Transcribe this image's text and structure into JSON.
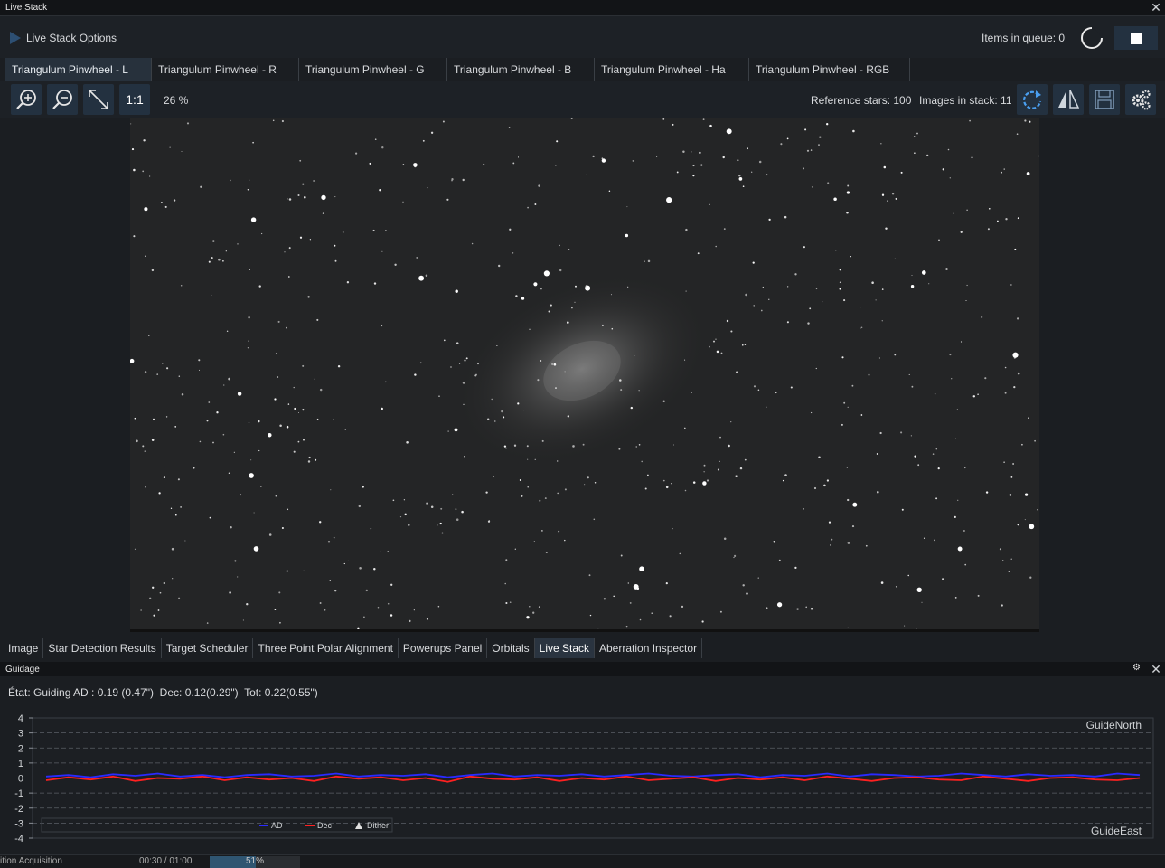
{
  "window_title": "Live Stack",
  "options": {
    "label": "Live Stack Options",
    "queue_label": "Items in queue: 0"
  },
  "tabs": [
    {
      "label": "Triangulum Pinwheel - L",
      "active": true
    },
    {
      "label": "Triangulum Pinwheel - R",
      "active": false
    },
    {
      "label": "Triangulum Pinwheel - G",
      "active": false
    },
    {
      "label": "Triangulum Pinwheel - B",
      "active": false
    },
    {
      "label": "Triangulum Pinwheel - Ha",
      "active": false
    },
    {
      "label": "Triangulum Pinwheel - RGB",
      "active": false
    }
  ],
  "toolbar": {
    "one_to_one": "1:1",
    "zoom": "26 %",
    "reference_stars": "Reference stars: 100",
    "images_in_stack": "Images in stack: 11"
  },
  "bottom_tabs": [
    {
      "label": "Image",
      "active": false
    },
    {
      "label": "Star Detection Results",
      "active": false
    },
    {
      "label": "Target Scheduler",
      "active": false
    },
    {
      "label": "Three Point Polar Alignment",
      "active": false
    },
    {
      "label": "Powerups Panel",
      "active": false
    },
    {
      "label": "Orbitals",
      "active": false
    },
    {
      "label": "Live Stack",
      "active": true
    },
    {
      "label": "Aberration Inspector",
      "active": false
    }
  ],
  "guiding": {
    "panel_title": "Guidage",
    "state": "État: Guiding AD : 0.19 (0.47\")  Dec: 0.12(0.29\")  Tot: 0.22(0.55\")",
    "label_north": "GuideNorth",
    "label_east": "GuideEast"
  },
  "chart_data": {
    "type": "line",
    "ylim": [
      -4,
      4
    ],
    "y_ticks": [
      "4",
      "3",
      "2",
      "1",
      "0",
      "-1",
      "-2",
      "-3",
      "-4"
    ],
    "legend": [
      "AD",
      "Dec",
      "Dither"
    ],
    "series": [
      {
        "name": "AD",
        "color": "#2a2aff",
        "values": [
          0.1,
          0.2,
          0.05,
          0.25,
          0.15,
          0.3,
          0.1,
          0.2,
          0.05,
          0.2,
          0.25,
          0.1,
          0.15,
          0.3,
          0.1,
          0.2,
          0.15,
          0.25,
          0.05,
          0.2,
          0.3,
          0.1,
          0.2,
          0.15,
          0.25,
          0.1,
          0.2,
          0.3,
          0.15,
          0.1,
          0.2,
          0.25,
          0.05,
          0.2,
          0.15,
          0.3,
          0.1,
          0.25,
          0.2,
          0.1,
          0.15,
          0.3,
          0.2,
          0.1,
          0.25,
          0.15,
          0.2,
          0.1,
          0.3,
          0.2
        ]
      },
      {
        "name": "Dec",
        "color": "#ff2020",
        "values": [
          -0.15,
          0.05,
          -0.1,
          0.1,
          -0.2,
          0.0,
          -0.05,
          0.1,
          -0.15,
          0.05,
          -0.1,
          0.0,
          -0.2,
          0.1,
          -0.05,
          0.05,
          -0.15,
          0.0,
          -0.25,
          0.1,
          -0.05,
          -0.1,
          0.05,
          -0.2,
          0.0,
          -0.1,
          0.1,
          -0.15,
          -0.05,
          0.05,
          -0.2,
          0.0,
          -0.1,
          0.05,
          -0.15,
          0.1,
          -0.05,
          -0.2,
          0.0,
          0.05,
          -0.1,
          -0.15,
          0.1,
          -0.05,
          -0.2,
          0.0,
          0.05,
          -0.1,
          -0.15,
          0.0
        ]
      }
    ]
  },
  "status": {
    "left": "ition Acquisition",
    "time": "00:30 / 01:00",
    "progress_text": "51%",
    "progress": 0.51
  },
  "colors": {
    "accent": "#3a8ee6",
    "button_bg": "#233140",
    "background": "#1b1e22"
  }
}
